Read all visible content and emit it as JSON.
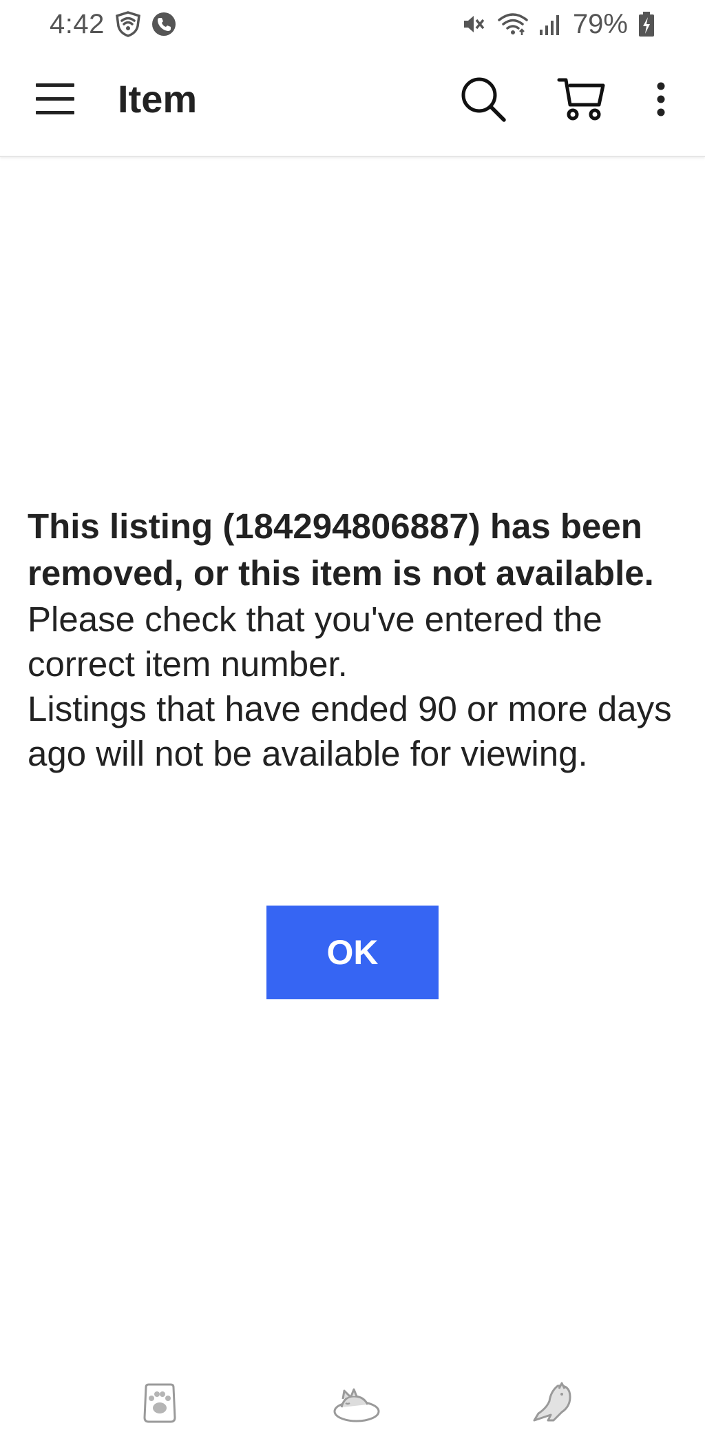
{
  "status_bar": {
    "time": "4:42",
    "battery_percent": "79%"
  },
  "app_bar": {
    "title": "Item"
  },
  "message": {
    "title": "This listing (184294806887) has been removed, or this item is not available.",
    "lines": [
      "Please check that you've entered the correct item number.",
      "Listings that have ended 90 or more days ago will not be available for viewing."
    ]
  },
  "ok_button": {
    "label": "OK",
    "color": "#3665f3"
  },
  "bottom_icons": [
    "paw-icon",
    "sleeping-cat-icon",
    "stretching-cat-icon"
  ]
}
